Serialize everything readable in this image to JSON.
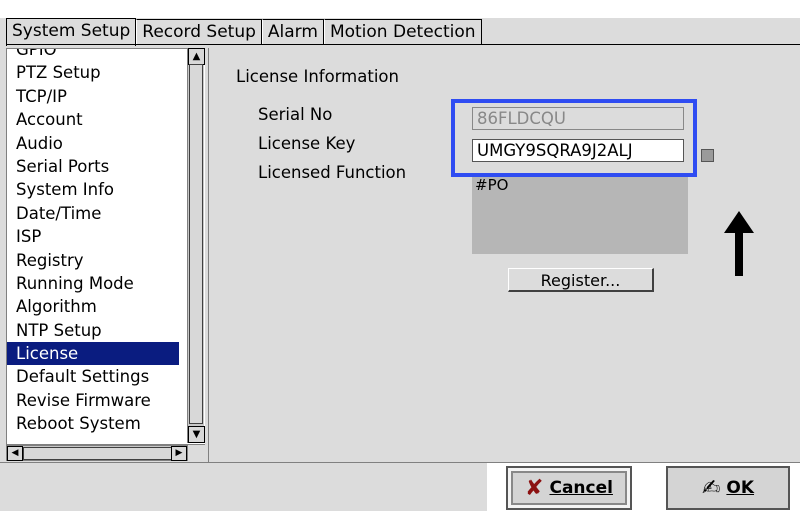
{
  "tabs": [
    {
      "label": "System Setup",
      "active": true
    },
    {
      "label": "Record Setup",
      "active": false
    },
    {
      "label": "Alarm",
      "active": false
    },
    {
      "label": "Motion Detection",
      "active": false
    }
  ],
  "sidebar": {
    "items": [
      {
        "label": "GPIO"
      },
      {
        "label": "PTZ Setup"
      },
      {
        "label": "TCP/IP"
      },
      {
        "label": "Account"
      },
      {
        "label": "Audio"
      },
      {
        "label": "Serial Ports"
      },
      {
        "label": "System Info"
      },
      {
        "label": "Date/Time"
      },
      {
        "label": "ISP"
      },
      {
        "label": "Registry"
      },
      {
        "label": "Running Mode"
      },
      {
        "label": "Algorithm"
      },
      {
        "label": "NTP Setup"
      },
      {
        "label": "License",
        "selected": true
      },
      {
        "label": "Default Settings"
      },
      {
        "label": "Revise Firmware"
      },
      {
        "label": "Reboot System"
      }
    ],
    "scroll_up": "▲",
    "scroll_down": "▼",
    "scroll_left": "◀",
    "scroll_right": "▶"
  },
  "license": {
    "section_title": "License Information",
    "serial_label": "Serial No",
    "serial_value": "86FLDCQU",
    "key_label": "License Key",
    "key_value": "UMGY9SQRA9J2ALJ",
    "function_label": "Licensed Function",
    "function_value": "#PO",
    "register_label": "Register..."
  },
  "footer": {
    "cancel_icon": "✘",
    "cancel_label": "Cancel",
    "ok_icon": "✍",
    "ok_label": "OK"
  },
  "colors": {
    "selection": "#0a1c80",
    "highlight_box": "#2f4cf2",
    "background": "#dcdcdc"
  }
}
